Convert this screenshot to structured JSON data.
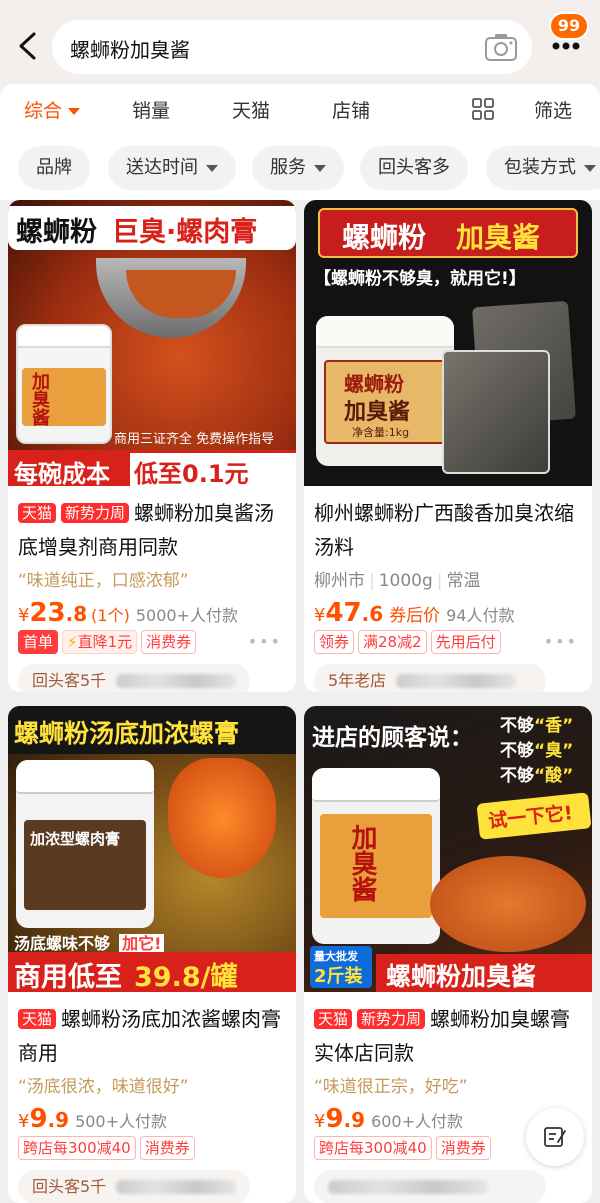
{
  "header": {
    "search_query": "螺蛳粉加臭酱",
    "badge_count": "99"
  },
  "tabs": [
    {
      "label": "综合"
    },
    {
      "label": "销量"
    },
    {
      "label": "天猫"
    },
    {
      "label": "店铺"
    },
    {
      "label": "筛选"
    }
  ],
  "filters": [
    {
      "label": "品牌"
    },
    {
      "label": "送达时间"
    },
    {
      "label": "服务"
    },
    {
      "label": "回头客多"
    },
    {
      "label": "包装方式"
    }
  ],
  "products": [
    {
      "image": {
        "banner_top_a": "螺蛳粉",
        "banner_top_b": "巨臭·螺肉膏",
        "jar_label": "加臭酱",
        "small_note": "商用三证齐全 免费操作指导",
        "banner_bottom_a": "每碗成本",
        "banner_bottom_b": "低至0.1元"
      },
      "tags": [
        "天猫",
        "新势力周"
      ],
      "title": "螺蛳粉加臭酱汤底增臭剂商用同款",
      "quote": "“味道纯正，口感浓郁”",
      "price_int": "23",
      "price_dec": ".8",
      "unit": "(1个)",
      "pays": "5000+人付款",
      "coupons": [
        "首单",
        "直降1元",
        "消费券"
      ],
      "shop": "回头客5千"
    },
    {
      "image": {
        "banner_top_a": "螺蛳粉",
        "banner_top_b": "加臭酱",
        "subtitle": "【螺蛳粉不够臭，就用它!】",
        "jar_label_a": "螺蛳粉",
        "jar_label_b": "加臭酱",
        "net": "净含量:1kg"
      },
      "tags": [],
      "title": "柳州螺蛳粉广西酸香加臭浓缩汤料",
      "meta": [
        "柳州市",
        "1000g",
        "常温"
      ],
      "price_int": "47",
      "price_dec": ".6",
      "after": "券后价",
      "pays": "94人付款",
      "coupons": [
        "领券",
        "满28减2",
        "先用后付"
      ],
      "shop": "5年老店"
    },
    {
      "image": {
        "banner_top": "螺蛳粉汤底加浓螺膏",
        "jar_label": "加浓型螺肉膏",
        "note_a": "汤底螺味不够",
        "note_b": "加它!",
        "banner_bottom_a": "商用低至",
        "banner_bottom_b": "39.8/罐"
      },
      "tags": [
        "天猫"
      ],
      "title": "螺蛳粉汤底加浓酱螺肉膏商用",
      "quote": "“汤底很浓，味道很好”",
      "price_int": "9",
      "price_dec": ".9",
      "pays": "500+人付款",
      "coupons": [
        "跨店每300减40",
        "消费券"
      ],
      "shop": "回头客5千"
    },
    {
      "image": {
        "banner_top": "进店的顾客说：",
        "line1_a": "不够",
        "line1_b": "“香”",
        "line2_a": "不够",
        "line2_b": "“臭”",
        "line3_a": "不够",
        "line3_b": "“酸”",
        "try": "试一下它!",
        "jar_label": "加臭酱",
        "bulk": "量大批发",
        "size": "2斤装",
        "banner_bottom": "螺蛳粉加臭酱"
      },
      "tags": [
        "天猫",
        "新势力周"
      ],
      "title": "螺蛳粉加臭螺膏实体店同款",
      "quote": "“味道很正宗，好吃”",
      "price_int": "9",
      "price_dec": ".9",
      "pays": "600+人付款",
      "coupons": [
        "跨店每300减40",
        "消费券"
      ],
      "shop": ""
    }
  ],
  "colors": {
    "accent": "#ff5000",
    "banner_red": "#d8211a",
    "banner_yellow": "#ffe23a"
  }
}
